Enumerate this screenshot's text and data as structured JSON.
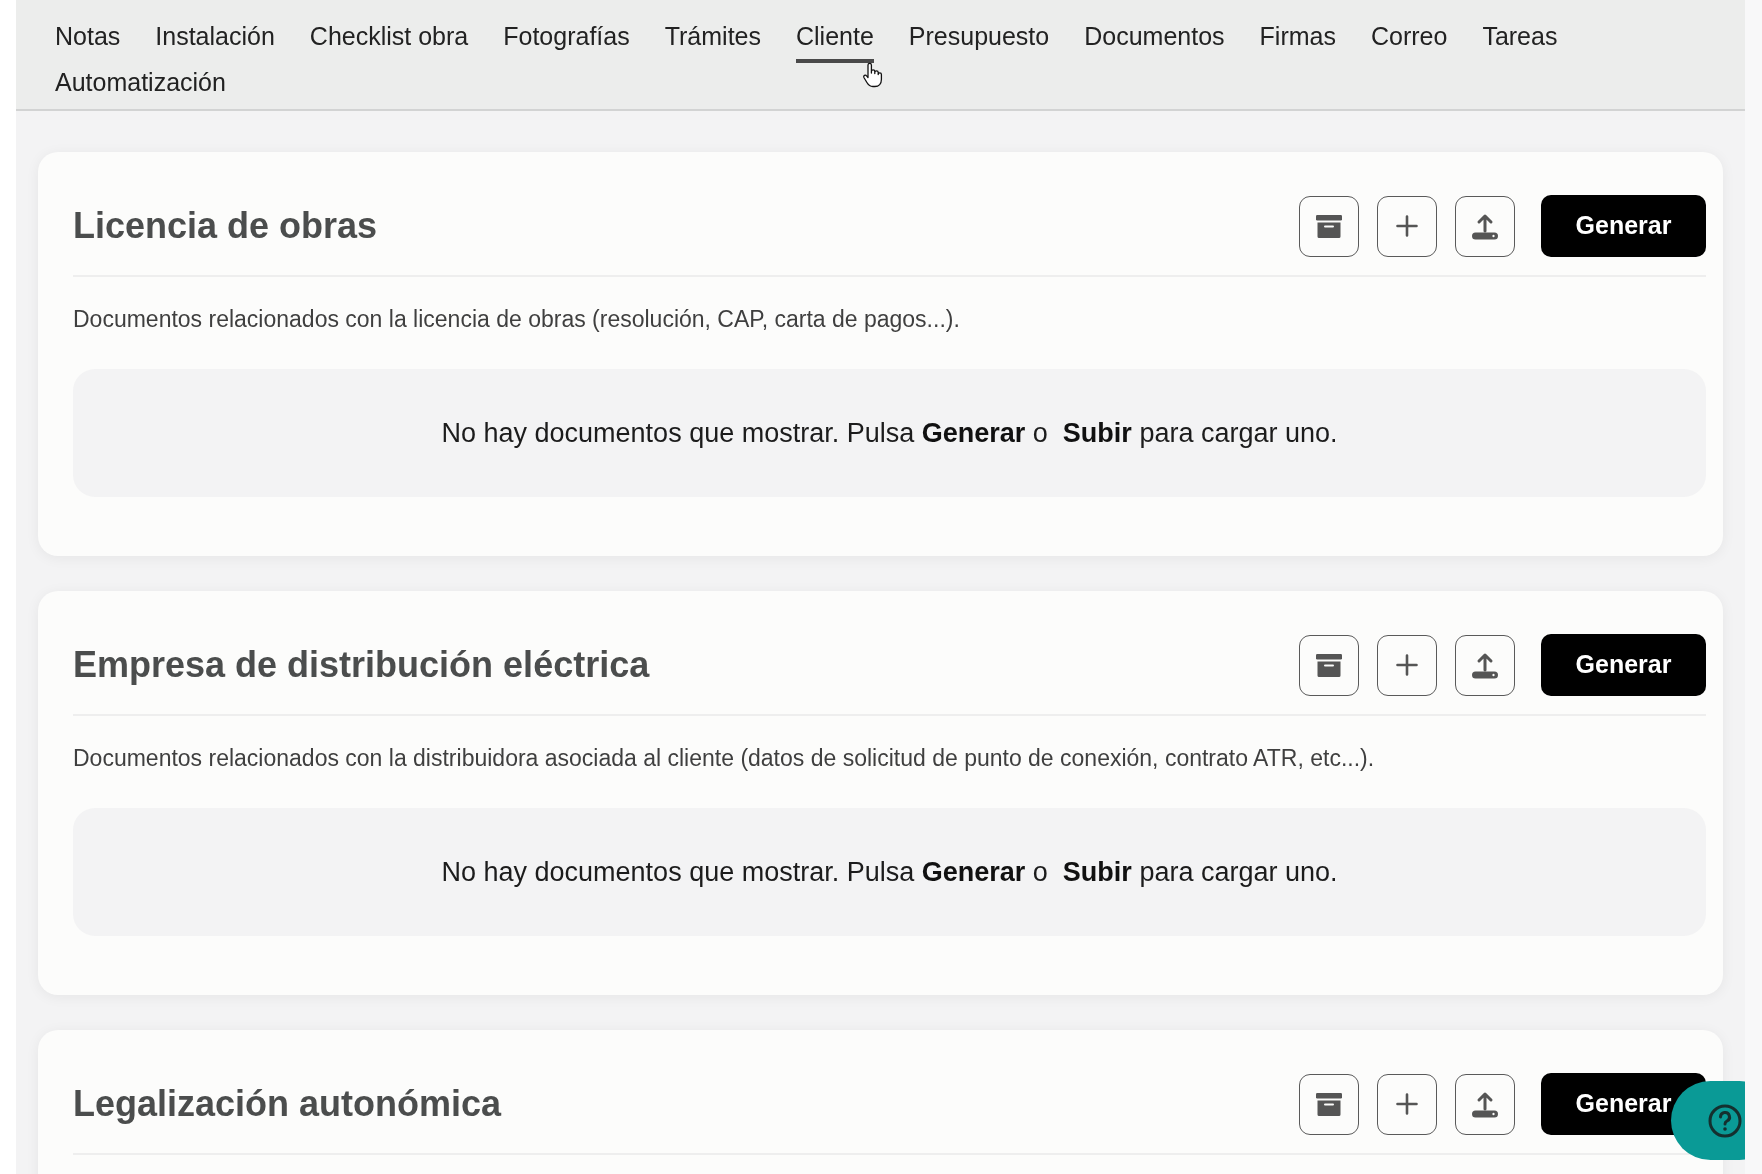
{
  "tabs": [
    {
      "label": "Notas",
      "selected": false
    },
    {
      "label": "Instalación",
      "selected": false
    },
    {
      "label": "Checklist obra",
      "selected": false
    },
    {
      "label": "Fotografías",
      "selected": false
    },
    {
      "label": "Trámites",
      "selected": false
    },
    {
      "label": "Cliente",
      "selected": true
    },
    {
      "label": "Presupuesto",
      "selected": false
    },
    {
      "label": "Documentos",
      "selected": false
    },
    {
      "label": "Firmas",
      "selected": false
    },
    {
      "label": "Correo",
      "selected": false
    },
    {
      "label": "Tareas",
      "selected": false
    },
    {
      "label": "Automatización",
      "selected": false
    }
  ],
  "sections": [
    {
      "title": "Licencia de obras",
      "generate_button": "Generar",
      "description": "Documentos relacionados con la licencia de obras (resolución, CAP, carta de pagos...).",
      "empty_message": "No hay documentos que mostrar. Pulsa **Generar** o  **Subir** para cargar uno."
    },
    {
      "title": "Empresa de distribución eléctrica",
      "generate_button": "Generar",
      "description": "Documentos relacionados con la distribuidora asociada al cliente (datos de solicitud de punto de conexión, contrato ATR, etc...).",
      "empty_message": "No hay documentos que mostrar. Pulsa **Generar** o  **Subir** para cargar uno."
    },
    {
      "title": "Legalización autonómica",
      "generate_button": "Generar"
    }
  ]
}
